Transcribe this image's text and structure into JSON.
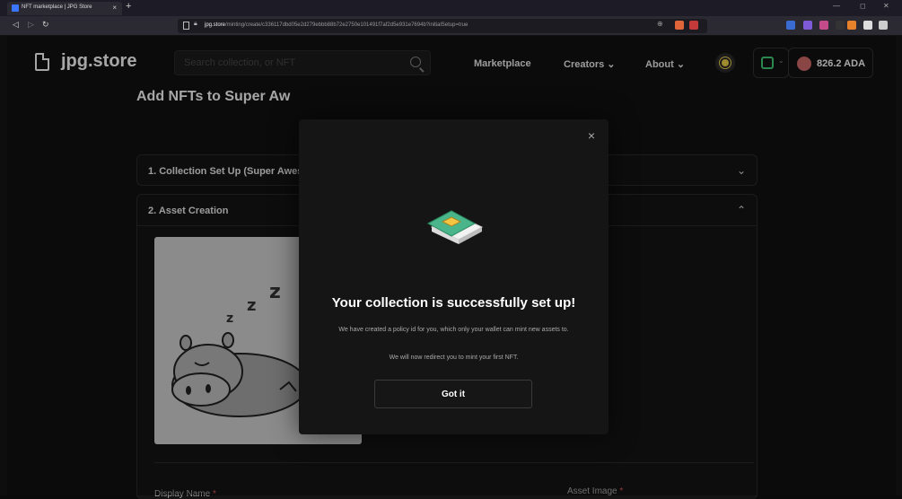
{
  "browser": {
    "tab_title": "NFT marketplace | JPG Store",
    "url_host": "jpg.store",
    "url_path": "/minting/create/c336117dbd05e2d279ebbb88b72e2750e101491f7af2d5e931e7694b?initialSetup=true",
    "tab_close": "×",
    "new_tab": "+"
  },
  "header": {
    "logo": "jpg.store",
    "search_placeholder": "Search collection, or NFT",
    "nav": {
      "marketplace": "Marketplace",
      "creators": "Creators ⌄",
      "about": "About ⌄"
    },
    "balance": "826.2 ADA"
  },
  "page": {
    "title": "Add NFTs to Super Aw",
    "sections": [
      {
        "label": "1. Collection Set Up (Super Awes",
        "chevron": "⌄"
      },
      {
        "label": "2. Asset Creation",
        "chevron": "⌃"
      }
    ],
    "fields": {
      "display_name": "Display Name",
      "asset_image": "Asset Image",
      "required": "*"
    }
  },
  "modal": {
    "close": "×",
    "heading": "Your collection is successfully set up!",
    "description": "We have created a policy id for you, which only your wallet can mint new assets to.",
    "redirect": "We will now redirect you to mint your first NFT.",
    "button": "Got it"
  },
  "colors": {
    "accent_green": "#44d07a",
    "required_red": "#e05a5a",
    "background": "#121212"
  }
}
